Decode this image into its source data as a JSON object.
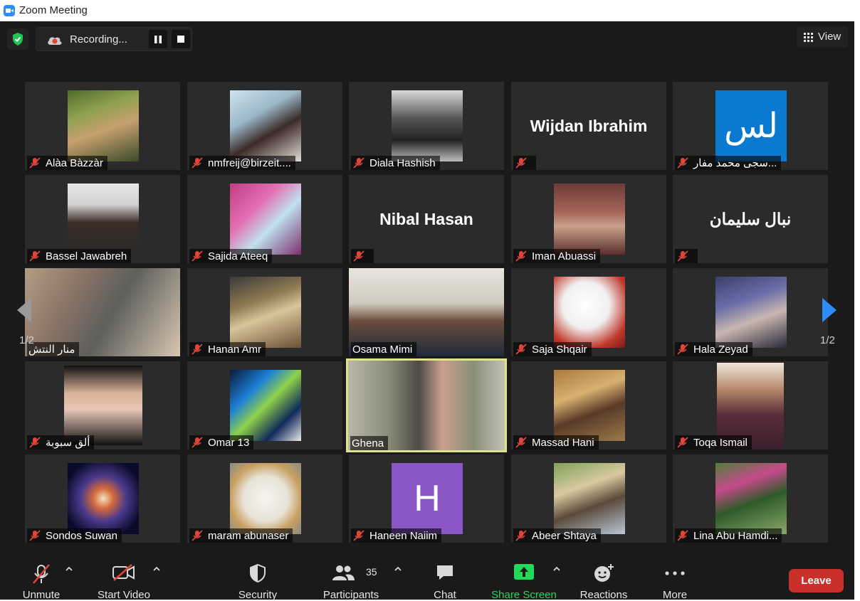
{
  "window": {
    "title": "Zoom Meeting"
  },
  "top": {
    "recording_label": "Recording...",
    "view_label": "View"
  },
  "pagination": {
    "left": "1/2",
    "right": "1/2"
  },
  "tiles": [
    {
      "name": "Alàa Bàzzàr"
    },
    {
      "name": "nmfreij@birzeit...."
    },
    {
      "name": "Diala Hashish"
    },
    {
      "name": "",
      "display_text": "Wijdan Ibrahim"
    },
    {
      "name": "سجى محمد مفار...",
      "avatar_text": "لس"
    },
    {
      "name": "Bassel Jawabreh"
    },
    {
      "name": "Sajida Ateeq"
    },
    {
      "name": "",
      "display_text": "Nibal Hasan"
    },
    {
      "name": "Iman Abuassi"
    },
    {
      "name": "",
      "display_text": "نبال سليمان"
    },
    {
      "name": "منار النتش"
    },
    {
      "name": "Hanan Amr"
    },
    {
      "name": "Osama Mimi"
    },
    {
      "name": "Saja Shqair"
    },
    {
      "name": "Hala Zeyad"
    },
    {
      "name": "ألق سبوبة"
    },
    {
      "name": "Omar 13"
    },
    {
      "name": "Ghena"
    },
    {
      "name": "Massad Hani"
    },
    {
      "name": "Toqa Ismail"
    },
    {
      "name": "Sondos Suwan"
    },
    {
      "name": "maram abunaser"
    },
    {
      "name": "Haneen Naiim",
      "avatar_text": "H"
    },
    {
      "name": "Abeer Shtaya"
    },
    {
      "name": "Lina Abu Hamdi..."
    }
  ],
  "toolbar": {
    "unmute": "Unmute",
    "start_video": "Start Video",
    "security": "Security",
    "participants": "Participants",
    "participants_count": "35",
    "chat": "Chat",
    "share_screen": "Share Screen",
    "reactions": "Reactions",
    "more": "More",
    "leave": "Leave"
  },
  "colors": {
    "share_green": "#23d959",
    "leave_red": "#c9302c",
    "active_speaker": "#dfe48a",
    "avatar_h": "#8b57c5",
    "avatar_blue": "#0a7ad0"
  }
}
